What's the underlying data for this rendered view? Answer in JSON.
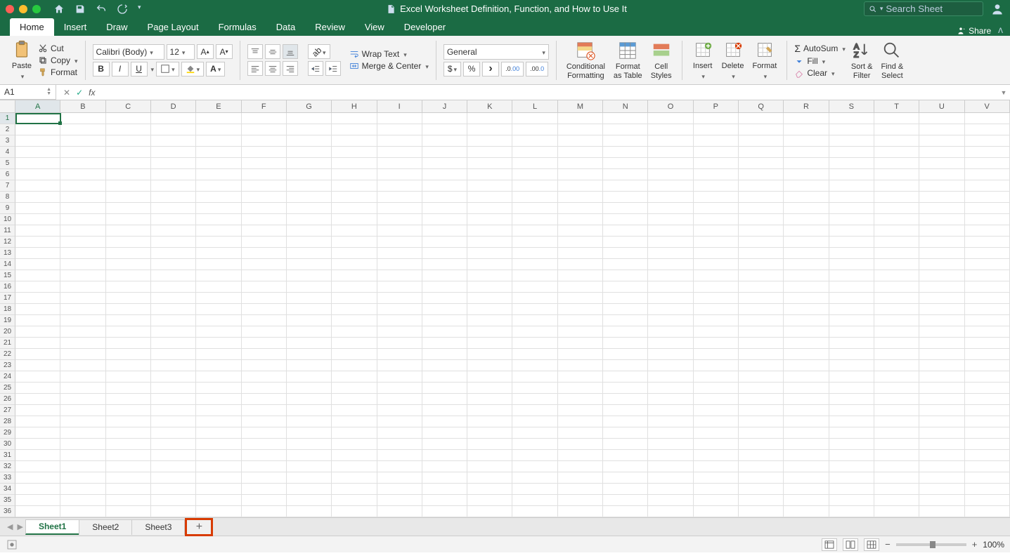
{
  "titlebar": {
    "title": "Excel Worksheet Definition, Function, and How to Use It",
    "search_placeholder": "Search Sheet"
  },
  "tabs": {
    "items": [
      "Home",
      "Insert",
      "Draw",
      "Page Layout",
      "Formulas",
      "Data",
      "Review",
      "View",
      "Developer"
    ],
    "active": "Home",
    "share": "Share"
  },
  "ribbon": {
    "clipboard": {
      "paste": "Paste",
      "cut": "Cut",
      "copy": "Copy",
      "format": "Format"
    },
    "font": {
      "name": "Calibri (Body)",
      "size": "12",
      "bold": "B",
      "italic": "I",
      "underline": "U"
    },
    "alignment": {
      "wrap": "Wrap Text",
      "merge": "Merge & Center"
    },
    "number": {
      "format": "General",
      "currency": "$",
      "percent": "%",
      "comma": ","
    },
    "styles": {
      "conditional": "Conditional\nFormatting",
      "table": "Format\nas Table",
      "cell": "Cell\nStyles"
    },
    "cells": {
      "insert": "Insert",
      "delete": "Delete",
      "format": "Format"
    },
    "editing": {
      "autosum": "AutoSum",
      "fill": "Fill",
      "clear": "Clear",
      "sort": "Sort &\nFilter",
      "find": "Find &\nSelect"
    }
  },
  "formula_bar": {
    "name_box": "A1",
    "fx": "fx"
  },
  "grid": {
    "columns": [
      "A",
      "B",
      "C",
      "D",
      "E",
      "F",
      "G",
      "H",
      "I",
      "J",
      "K",
      "L",
      "M",
      "N",
      "O",
      "P",
      "Q",
      "R",
      "S",
      "T",
      "U",
      "V"
    ],
    "rows": [
      "1",
      "2",
      "3",
      "4",
      "5",
      "6",
      "7",
      "8",
      "9",
      "10",
      "11",
      "12",
      "13",
      "14",
      "15",
      "16",
      "17",
      "18",
      "19",
      "20",
      "21",
      "22",
      "23",
      "24",
      "25",
      "26",
      "27",
      "28",
      "29",
      "30",
      "31",
      "32",
      "33",
      "34",
      "35",
      "36"
    ],
    "active_cell": "A1"
  },
  "sheets": {
    "tabs": [
      "Sheet1",
      "Sheet2",
      "Sheet3"
    ],
    "active": "Sheet1",
    "add": "+"
  },
  "status": {
    "zoom": "100%"
  }
}
